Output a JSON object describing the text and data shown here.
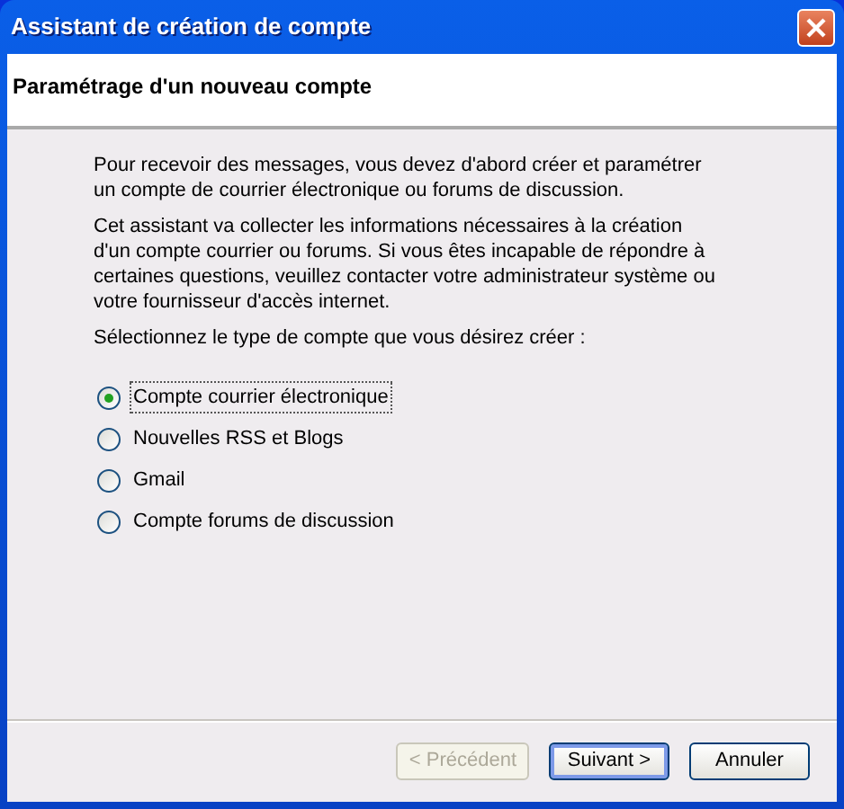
{
  "window": {
    "title": "Assistant de création de compte"
  },
  "header": {
    "title": "Paramétrage d'un nouveau compte"
  },
  "paragraphs": [
    "Pour recevoir des messages, vous devez d'abord créer et paramétrer un compte de courrier électronique ou forums de discussion.",
    "Cet assistant va collecter les informations nécessaires à la création d'un compte courrier ou forums. Si vous êtes incapable de répondre à certaines questions, veuillez contacter votre administrateur système ou votre fournisseur d'accès internet.",
    "Sélectionnez le type de compte que vous désirez créer :"
  ],
  "account_types": [
    {
      "label": "Compte courrier électronique",
      "selected": true
    },
    {
      "label": "Nouvelles RSS et Blogs",
      "selected": false
    },
    {
      "label": "Gmail",
      "selected": false
    },
    {
      "label": "Compte forums de discussion",
      "selected": false
    }
  ],
  "buttons": [
    {
      "label": "< Précédent",
      "disabled": true,
      "default": false
    },
    {
      "label": "Suivant >",
      "disabled": false,
      "default": true
    },
    {
      "label": "Annuler",
      "disabled": false,
      "default": false
    }
  ]
}
